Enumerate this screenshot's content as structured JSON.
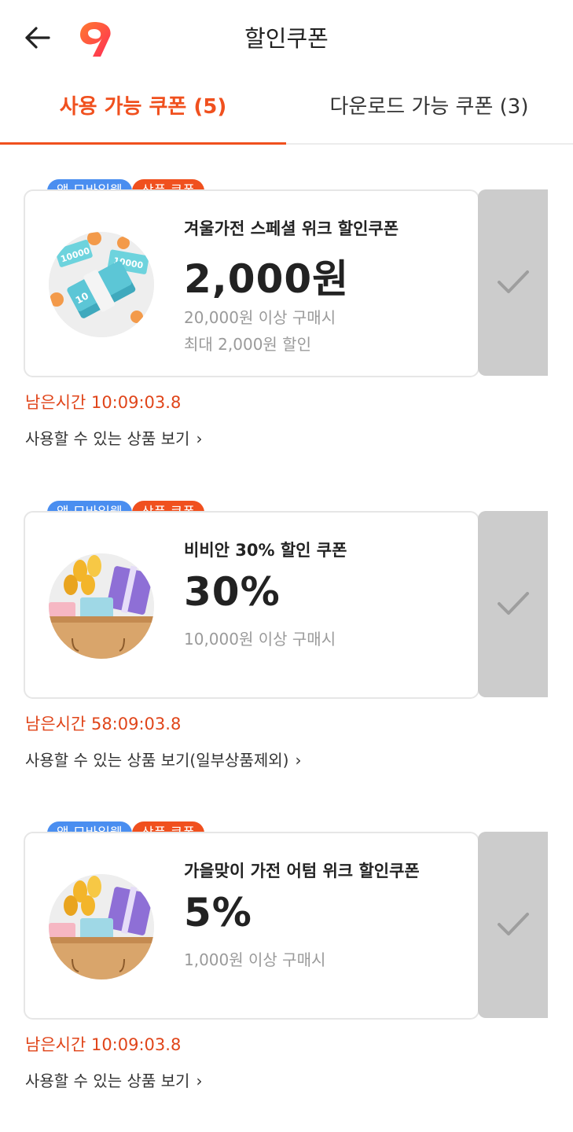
{
  "header": {
    "title": "할인쿠폰"
  },
  "tabs": [
    {
      "label": "사용 가능 쿠폰 (5)",
      "active": true
    },
    {
      "label": "다운로드 가능 쿠폰 (3)",
      "active": false
    }
  ],
  "colors": {
    "accent": "#f0501e",
    "badge_app": "#4a8ef0",
    "apply_button": "#cccccc"
  },
  "coupons": [
    {
      "badge_channel": "앱·모바일웹",
      "badge_type": "상품 쿠폰",
      "name": "겨울가전 스페셜 위크 할인쿠폰",
      "amount": "2,000원",
      "condition": "20,000원 이상 구매시",
      "max_discount": "최대 2,000원 할인",
      "image": "money-bundle-icon",
      "remaining": "남은시간 10:09:03.8",
      "view_link": "사용할 수 있는 상품 보기"
    },
    {
      "badge_channel": "앱·모바일웹",
      "badge_type": "상품 쿠폰",
      "name": "비비안 30% 할인 쿠폰",
      "amount": "30%",
      "condition": "10,000원 이상 구매시",
      "max_discount": "",
      "image": "gift-bag-icon",
      "remaining": "남은시간 58:09:03.8",
      "view_link": "사용할 수 있는 상품 보기(일부상품제외)"
    },
    {
      "badge_channel": "앱·모바일웹",
      "badge_type": "상품 쿠폰",
      "name": "가을맞이 가전 어텀 위크 할인쿠폰",
      "amount": "5%",
      "condition": "1,000원 이상 구매시",
      "max_discount": "",
      "image": "gift-bag-icon",
      "remaining": "남은시간 10:09:03.8",
      "view_link": "사용할 수 있는 상품 보기"
    }
  ]
}
